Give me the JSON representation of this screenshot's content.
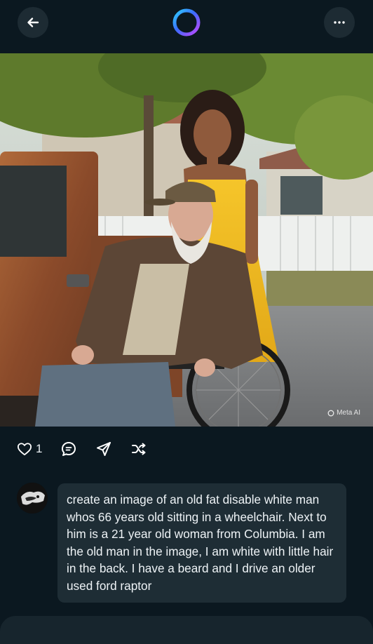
{
  "header": {
    "back_icon": "arrow-left-icon",
    "logo_icon": "meta-ai-ring-icon",
    "more_icon": "more-dots-icon"
  },
  "image": {
    "watermark": "Meta AI"
  },
  "actions": {
    "like_count": "1",
    "icons": [
      "heart-icon",
      "comment-icon",
      "share-icon",
      "shuffle-icon"
    ]
  },
  "prompt": {
    "avatar_icon": "user-avatar",
    "text": "create an image  of an old fat disable white man whos 66 years old sitting in a wheelchair. Next to him is a 21 year old woman from Columbia. I am the old man in the image, I am white with little hair in the back. I have a beard and I drive an older used ford raptor"
  },
  "colors": {
    "background": "#0b1820",
    "bubble": "#1e2d35",
    "button": "#1d2b33",
    "ring_start": "#3b6bff",
    "ring_end": "#a34bff"
  }
}
